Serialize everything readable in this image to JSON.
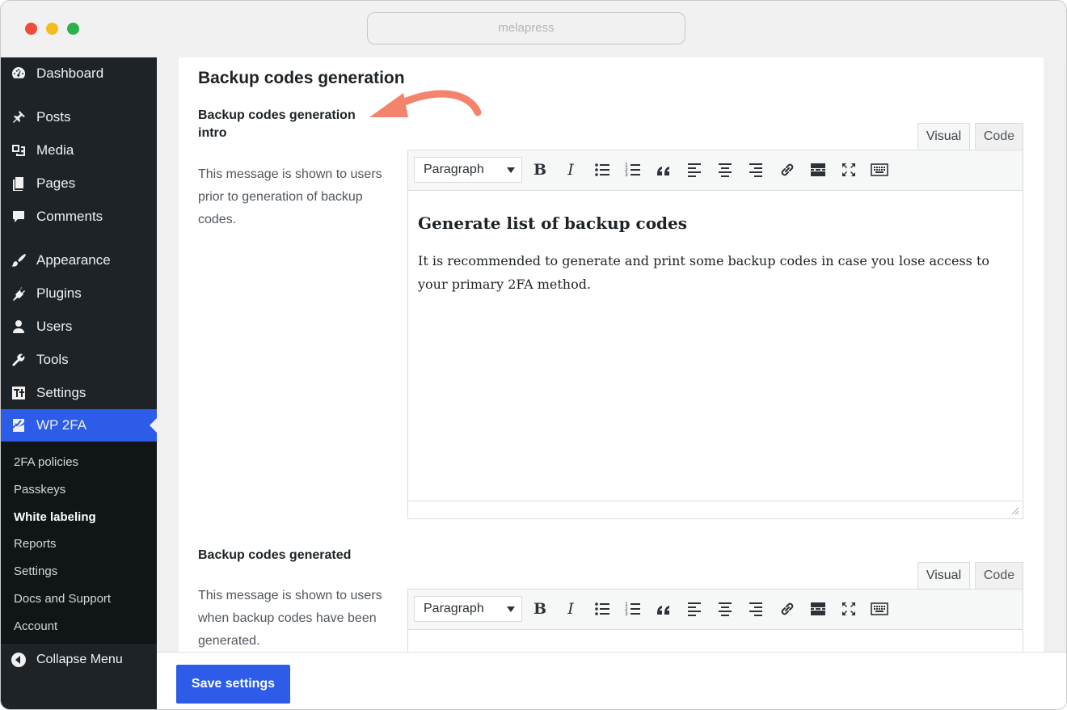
{
  "browser": {
    "url": "melapress"
  },
  "sidebar": {
    "items": [
      {
        "label": "Dashboard",
        "icon": "dashboard-icon"
      },
      {
        "label": "Posts",
        "icon": "pin-icon"
      },
      {
        "label": "Media",
        "icon": "media-icon"
      },
      {
        "label": "Pages",
        "icon": "pages-icon"
      },
      {
        "label": "Comments",
        "icon": "comment-icon"
      },
      {
        "label": "Appearance",
        "icon": "brush-icon"
      },
      {
        "label": "Plugins",
        "icon": "plug-icon"
      },
      {
        "label": "Users",
        "icon": "user-icon"
      },
      {
        "label": "Tools",
        "icon": "wrench-icon"
      },
      {
        "label": "Settings",
        "icon": "settings-icon"
      },
      {
        "label": "WP 2FA",
        "icon": "wp2fa-icon"
      }
    ],
    "submenu": [
      "2FA policies",
      "Passkeys",
      "White labeling",
      "Reports",
      "Settings",
      "Docs and Support",
      "Account"
    ],
    "current_submenu": "White labeling",
    "collapse_label": "Collapse Menu",
    "active_color": "#2c5ce8"
  },
  "main": {
    "section_title": "Backup codes generation",
    "fields": [
      {
        "label": "Backup codes generation intro",
        "description": "This message is shown to users prior to generation of backup codes.",
        "editor": {
          "tabs": [
            "Visual",
            "Code"
          ],
          "format": "Paragraph",
          "heading": "Generate list of backup codes",
          "paragraph": "It is recommended to generate and print some backup codes in case you lose access to your primary 2FA method."
        }
      },
      {
        "label": "Backup codes generated",
        "description": "This message is shown to users when backup codes have been generated.",
        "editor": {
          "tabs": [
            "Visual",
            "Code"
          ],
          "format": "Paragraph"
        }
      }
    ]
  },
  "footer": {
    "save_label": "Save settings"
  },
  "colors": {
    "annotation_arrow": "#f4836d",
    "primary_button": "#2c5ce8"
  }
}
